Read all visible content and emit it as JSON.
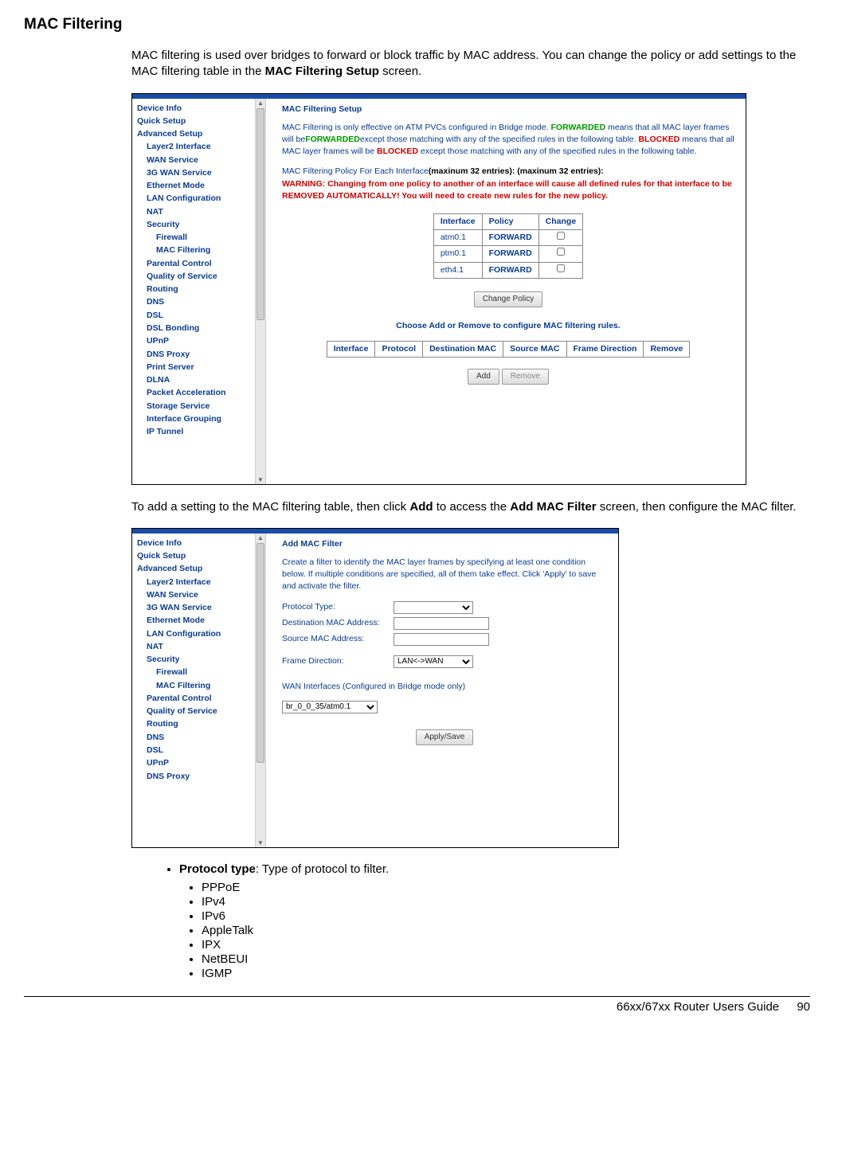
{
  "page": {
    "title": "MAC Filtering",
    "intro_a": "MAC filtering is used over bridges to forward or block traffic by MAC address. You can change the policy or add settings to the MAC filtering table in the ",
    "intro_b": "MAC Filtering Setup",
    "intro_c": " screen.",
    "mid_a": "To add a setting to the MAC filtering table, then click ",
    "mid_b": "Add",
    "mid_c": " to access the ",
    "mid_d": "Add MAC Filter",
    "mid_e": " screen, then configure the MAC filter.",
    "protocol_label": "Protocol type",
    "protocol_desc": ": Type of protocol to filter.",
    "protocols": [
      "PPPoE",
      "IPv4",
      "IPv6",
      "AppleTalk",
      "IPX",
      "NetBEUI",
      "IGMP"
    ],
    "footer_title": "66xx/67xx Router Users Guide",
    "footer_page": "90"
  },
  "nav1": [
    "Device Info",
    "Quick Setup",
    "Advanced Setup"
  ],
  "nav1_sub": [
    "Layer2 Interface",
    "WAN Service",
    "3G WAN Service",
    "Ethernet Mode",
    "LAN Configuration",
    "NAT",
    "Security"
  ],
  "nav1_sub2": [
    "Firewall",
    "MAC Filtering"
  ],
  "nav1_sub_after": [
    "Parental Control",
    "Quality of Service",
    "Routing",
    "DNS",
    "DSL",
    "DSL Bonding",
    "UPnP",
    "DNS Proxy",
    "Print Server",
    "DLNA",
    "Packet Acceleration",
    "Storage Service",
    "Interface Grouping",
    "IP Tunnel"
  ],
  "nav2": [
    "Device Info",
    "Quick Setup",
    "Advanced Setup"
  ],
  "nav2_sub": [
    "Layer2 Interface",
    "WAN Service",
    "3G WAN Service",
    "Ethernet Mode",
    "LAN Configuration",
    "NAT",
    "Security"
  ],
  "nav2_sub2": [
    "Firewall",
    "MAC Filtering"
  ],
  "nav2_sub_after": [
    "Parental Control",
    "Quality of Service",
    "Routing",
    "DNS",
    "DSL",
    "UPnP",
    "DNS Proxy"
  ],
  "ss1": {
    "title": "MAC Filtering Setup",
    "p1a": "MAC Filtering is only effective on ATM PVCs configured in Bridge mode. ",
    "p1b": "FORWARDED",
    "p1c": " means that all MAC layer frames will be",
    "p1d": "FORWARDED",
    "p1e": "except those matching with any of the specified rules in the following table. ",
    "p1f": "BLOCKED",
    "p1g": " means that all MAC layer frames will be ",
    "p1h": "BLOCKED",
    "p1i": " except those matching with any of the specified rules in the following table.",
    "p2a": "MAC Filtering Policy For Each Interface",
    "p2b": "(maxinum 32 entries): (maxinum 32 entries):",
    "warn_label": "WARNING: ",
    "warn_a": "Changing from one policy to another of an interface will cause all defined rules for that interface to be REMOVED AUTOMATICALLY! You will need to create new rules for the new policy.",
    "policy_headers": [
      "Interface",
      "Policy",
      "Change"
    ],
    "policy_rows": [
      {
        "if": "atm0.1",
        "pol": "FORWARD"
      },
      {
        "if": "ptm0.1",
        "pol": "FORWARD"
      },
      {
        "if": "eth4.1",
        "pol": "FORWARD"
      }
    ],
    "btn_change": "Change Policy",
    "choose_line": "Choose Add or Remove to configure MAC filtering rules.",
    "rules_headers": [
      "Interface",
      "Protocol",
      "Destination MAC",
      "Source MAC",
      "Frame Direction",
      "Remove"
    ],
    "btn_add": "Add",
    "btn_remove": "Remove"
  },
  "ss2": {
    "title": "Add MAC Filter",
    "p1": "Create a filter to identify the MAC layer frames by specifying at least one condition below. If multiple conditions are specified, all of them take effect. Click 'Apply' to save and activate the filter.",
    "f_proto": "Protocol Type:",
    "f_dmac": "Destination MAC Address:",
    "f_smac": "Source MAC Address:",
    "f_fdir": "Frame Direction:",
    "fdir_val": "LAN<->WAN",
    "wan_line": "WAN Interfaces (Configured in Bridge mode only)",
    "wan_sel": "br_0_0_35/atm0.1",
    "btn_apply": "Apply/Save"
  }
}
